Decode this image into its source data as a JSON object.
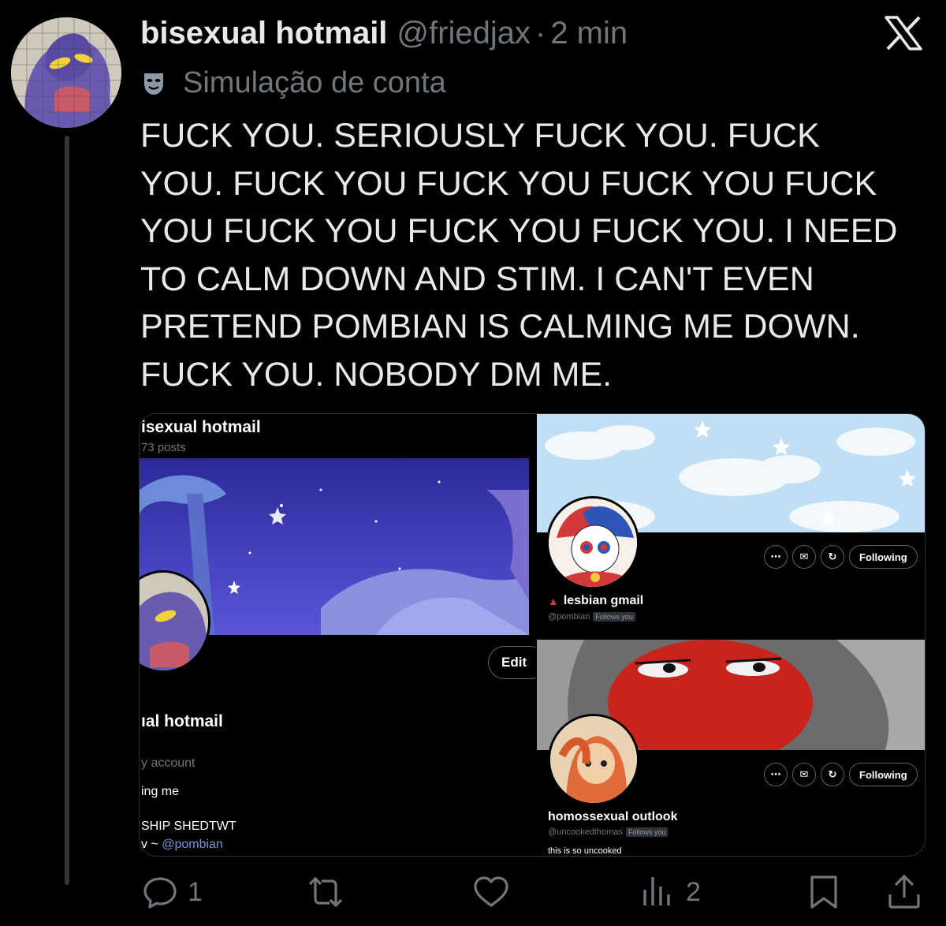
{
  "tweet": {
    "display_name": "bisexual hotmail",
    "handle": "@friedjax",
    "separator": "·",
    "time": "2 min",
    "simulation_label": "Simulação de conta",
    "lines": [
      "FUCK YOU. SERIOUSLY FUCK YOU. FUCK",
      "YOU. FUCK YOU FUCK YOU FUCK YOU FUCK",
      "YOU FUCK YOU FUCK YOU FUCK YOU. I NEED",
      "TO CALM DOWN AND STIM. I CAN'T EVEN",
      "PRETEND POMBIAN IS CALMING ME DOWN.",
      "FUCK YOU. NOBODY DM ME."
    ]
  },
  "media": {
    "left": {
      "title": "isexual hotmail",
      "posts": "73 posts",
      "edit_label": "Edit",
      "name": "ıal hotmail",
      "sub": "y account",
      "bio_line1": "ing me",
      "bio_line2": "SHIP SHEDTWT",
      "bio_line3_prefix": "v ~ ",
      "bio_mention": "@pombian"
    },
    "right_top": {
      "name": "lesbian gmail",
      "handle": "@pombian",
      "follows_you": "Follows you",
      "following_label": "Following"
    },
    "right_bottom": {
      "name": "homossexual outlook",
      "handle": "@uncookedthomas",
      "follows_you": "Follows you",
      "bio": "this is so uncooked",
      "following_label": "Following"
    }
  },
  "actions": {
    "replies": "1",
    "reposts": "",
    "likes": "",
    "views": "2"
  },
  "colors": {
    "background": "#000000",
    "text_primary": "#e7e9ea",
    "text_secondary": "#71767b",
    "mention": "#6a9ae0"
  }
}
